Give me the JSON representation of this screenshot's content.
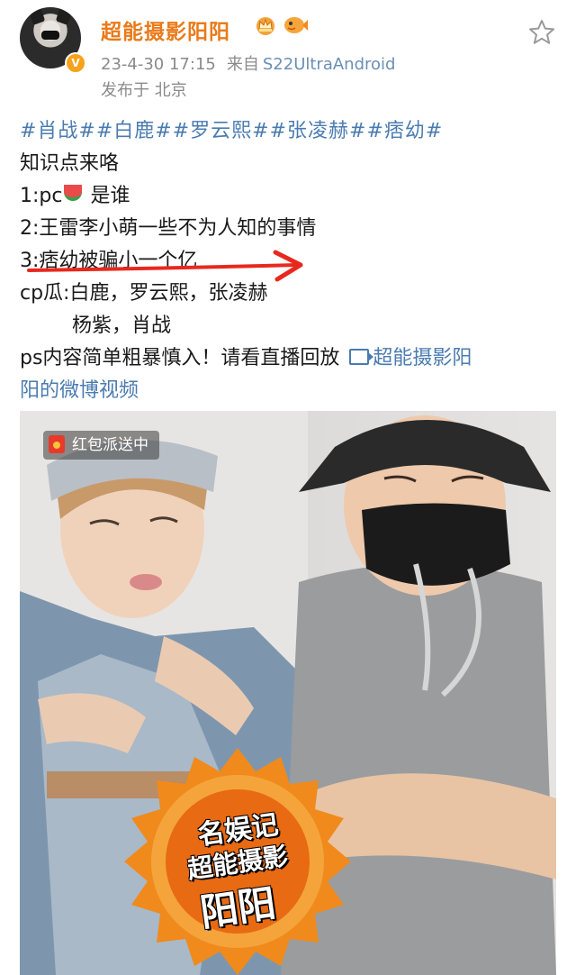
{
  "post": {
    "username": "超能摄影阳阳",
    "timestamp": "23-4-30 17:15",
    "source_prefix": "来自",
    "device": "S22UltraAndroid",
    "location": "发布于 北京",
    "icons": {
      "crown_badge": "crown-badge-icon",
      "fish_badge": "fish-badge-icon",
      "verified": "verified-v-icon",
      "favorite": "star-icon"
    },
    "verified_mark": "V"
  },
  "content": {
    "tags": "#肖战##白鹿##罗云熙##张凌赫##痞幼#",
    "line1": "知识点来咯",
    "line2_prefix": "1:pc",
    "line2_suffix": " 是谁",
    "line3": "2:王雷李小萌一些不为人知的事情",
    "line4": "3:痞幼被骗小一个亿",
    "line5": "cp瓜:白鹿，罗云熙，张凌赫",
    "line6": "杨紫，肖战",
    "line7_prefix": "ps内容简单粗暴慎入！请看直播回放 ",
    "link_text_a": "超能摄影阳",
    "link_text_b": "阳的微博视频"
  },
  "media": {
    "live_tag": "红包派送中",
    "stamp_line1": "名娱记",
    "stamp_line2": "超能摄影",
    "stamp_line3": "阳阳"
  },
  "colors": {
    "username": "#ea7a1a",
    "link": "#4a7bb0",
    "meta": "#8a8a8a",
    "arrow": "#e8281e",
    "stamp_orange": "#f08a1c"
  }
}
